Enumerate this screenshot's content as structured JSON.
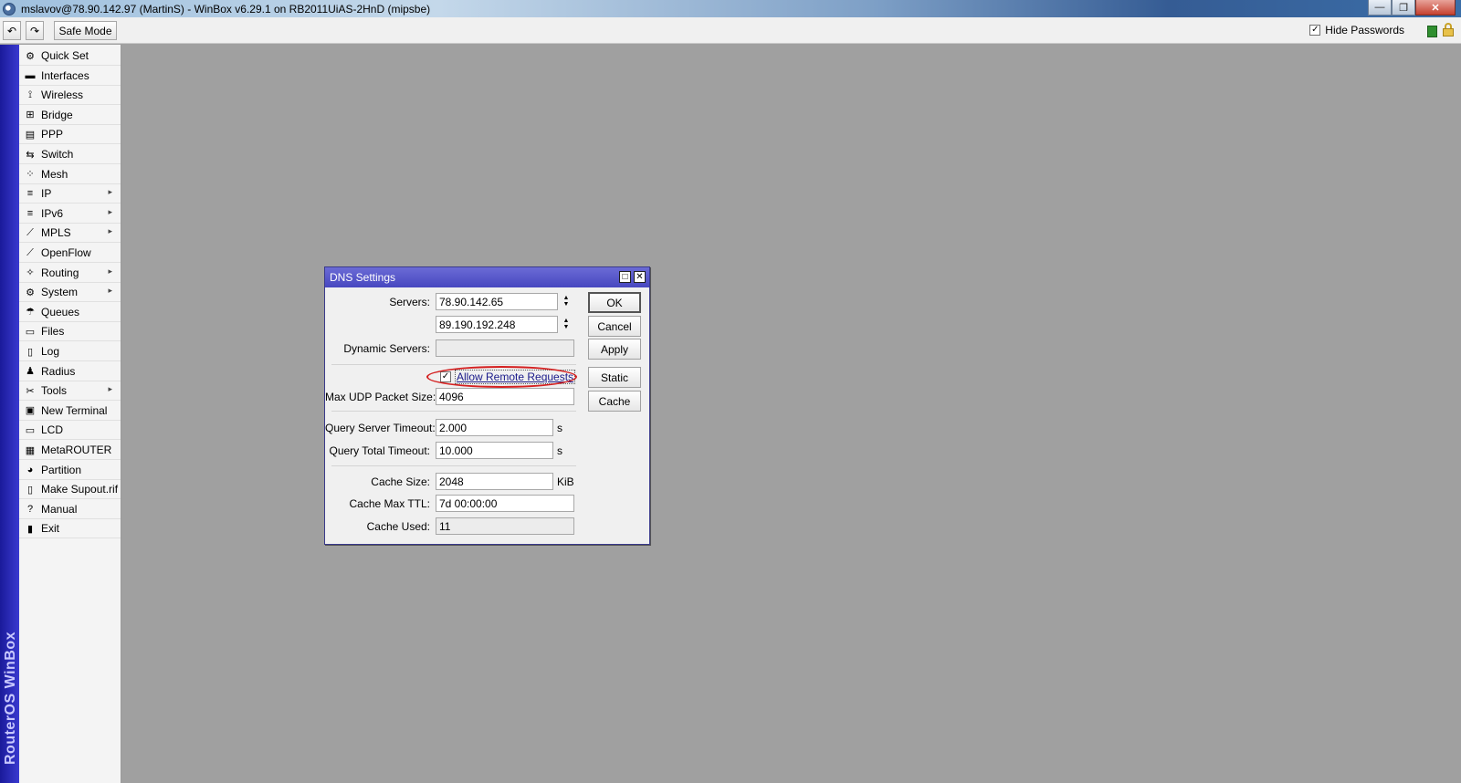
{
  "window": {
    "title": "mslavov@78.90.142.97 (MartinS) - WinBox v6.29.1 on RB2011UiAS-2HnD (mipsbe)",
    "controls": {
      "minimize": "—",
      "restore": "❐",
      "close": "✕"
    }
  },
  "toolbar": {
    "undo_icon": "↶",
    "redo_icon": "↷",
    "safe_mode_label": "Safe Mode",
    "hide_passwords_label": "Hide Passwords",
    "hide_passwords_checked": "✓"
  },
  "sidebar": {
    "brand": "RouterOS WinBox",
    "items": [
      {
        "label": "Quick Set",
        "icon": "quick-set",
        "glyph": "⚙",
        "submenu": false
      },
      {
        "label": "Interfaces",
        "icon": "interfaces",
        "glyph": "▬",
        "submenu": false
      },
      {
        "label": "Wireless",
        "icon": "wireless",
        "glyph": "⟟",
        "submenu": false
      },
      {
        "label": "Bridge",
        "icon": "bridge",
        "glyph": "⊞",
        "submenu": false
      },
      {
        "label": "PPP",
        "icon": "ppp",
        "glyph": "▤",
        "submenu": false
      },
      {
        "label": "Switch",
        "icon": "switch",
        "glyph": "⇆",
        "submenu": false
      },
      {
        "label": "Mesh",
        "icon": "mesh",
        "glyph": "⁘",
        "submenu": false
      },
      {
        "label": "IP",
        "icon": "ip",
        "glyph": "≡",
        "submenu": true
      },
      {
        "label": "IPv6",
        "icon": "ipv6",
        "glyph": "≡",
        "submenu": true
      },
      {
        "label": "MPLS",
        "icon": "mpls",
        "glyph": "⟋",
        "submenu": true
      },
      {
        "label": "OpenFlow",
        "icon": "openflow",
        "glyph": "⟋",
        "submenu": false
      },
      {
        "label": "Routing",
        "icon": "routing",
        "glyph": "✧",
        "submenu": true
      },
      {
        "label": "System",
        "icon": "system",
        "glyph": "⚙",
        "submenu": true
      },
      {
        "label": "Queues",
        "icon": "queues",
        "glyph": "☂",
        "submenu": false
      },
      {
        "label": "Files",
        "icon": "files",
        "glyph": "▭",
        "submenu": false
      },
      {
        "label": "Log",
        "icon": "log",
        "glyph": "▯",
        "submenu": false
      },
      {
        "label": "Radius",
        "icon": "radius",
        "glyph": "♟",
        "submenu": false
      },
      {
        "label": "Tools",
        "icon": "tools",
        "glyph": "✂",
        "submenu": true
      },
      {
        "label": "New Terminal",
        "icon": "terminal",
        "glyph": "▣",
        "submenu": false
      },
      {
        "label": "LCD",
        "icon": "lcd",
        "glyph": "▭",
        "submenu": false
      },
      {
        "label": "MetaROUTER",
        "icon": "metarouter",
        "glyph": "▦",
        "submenu": false
      },
      {
        "label": "Partition",
        "icon": "partition",
        "glyph": "◕",
        "submenu": false
      },
      {
        "label": "Make Supout.rif",
        "icon": "supout",
        "glyph": "▯",
        "submenu": false
      },
      {
        "label": "Manual",
        "icon": "manual",
        "glyph": "?",
        "submenu": false
      },
      {
        "label": "Exit",
        "icon": "exit",
        "glyph": "▮",
        "submenu": false
      }
    ],
    "submenu_arrow": "▸"
  },
  "dialog": {
    "title": "DNS Settings",
    "maximize_icon": "□",
    "close_icon": "✕",
    "labels": {
      "servers": "Servers:",
      "dynamic_servers": "Dynamic Servers:",
      "allow_remote_requests": "Allow Remote Requests",
      "max_udp_packet_size": "Max UDP Packet Size:",
      "query_server_timeout": "Query Server Timeout:",
      "query_total_timeout": "Query Total Timeout:",
      "cache_size": "Cache Size:",
      "cache_max_ttl": "Cache Max TTL:",
      "cache_used": "Cache Used:"
    },
    "values": {
      "server_1": "78.90.142.65",
      "server_2": "89.190.192.248",
      "dynamic_servers": "",
      "allow_remote_requests_checked": "✓",
      "max_udp_packet_size": "4096",
      "query_server_timeout": "2.000",
      "query_total_timeout": "10.000",
      "cache_size": "2048",
      "cache_max_ttl": "7d 00:00:00",
      "cache_used": "11"
    },
    "units": {
      "query_server_timeout": "s",
      "query_total_timeout": "s",
      "cache_size": "KiB"
    },
    "updown_up": "▲",
    "updown_down": "▼",
    "buttons": {
      "ok": "OK",
      "cancel": "Cancel",
      "apply": "Apply",
      "static": "Static",
      "cache": "Cache"
    },
    "highlight_color": "#d42020"
  }
}
